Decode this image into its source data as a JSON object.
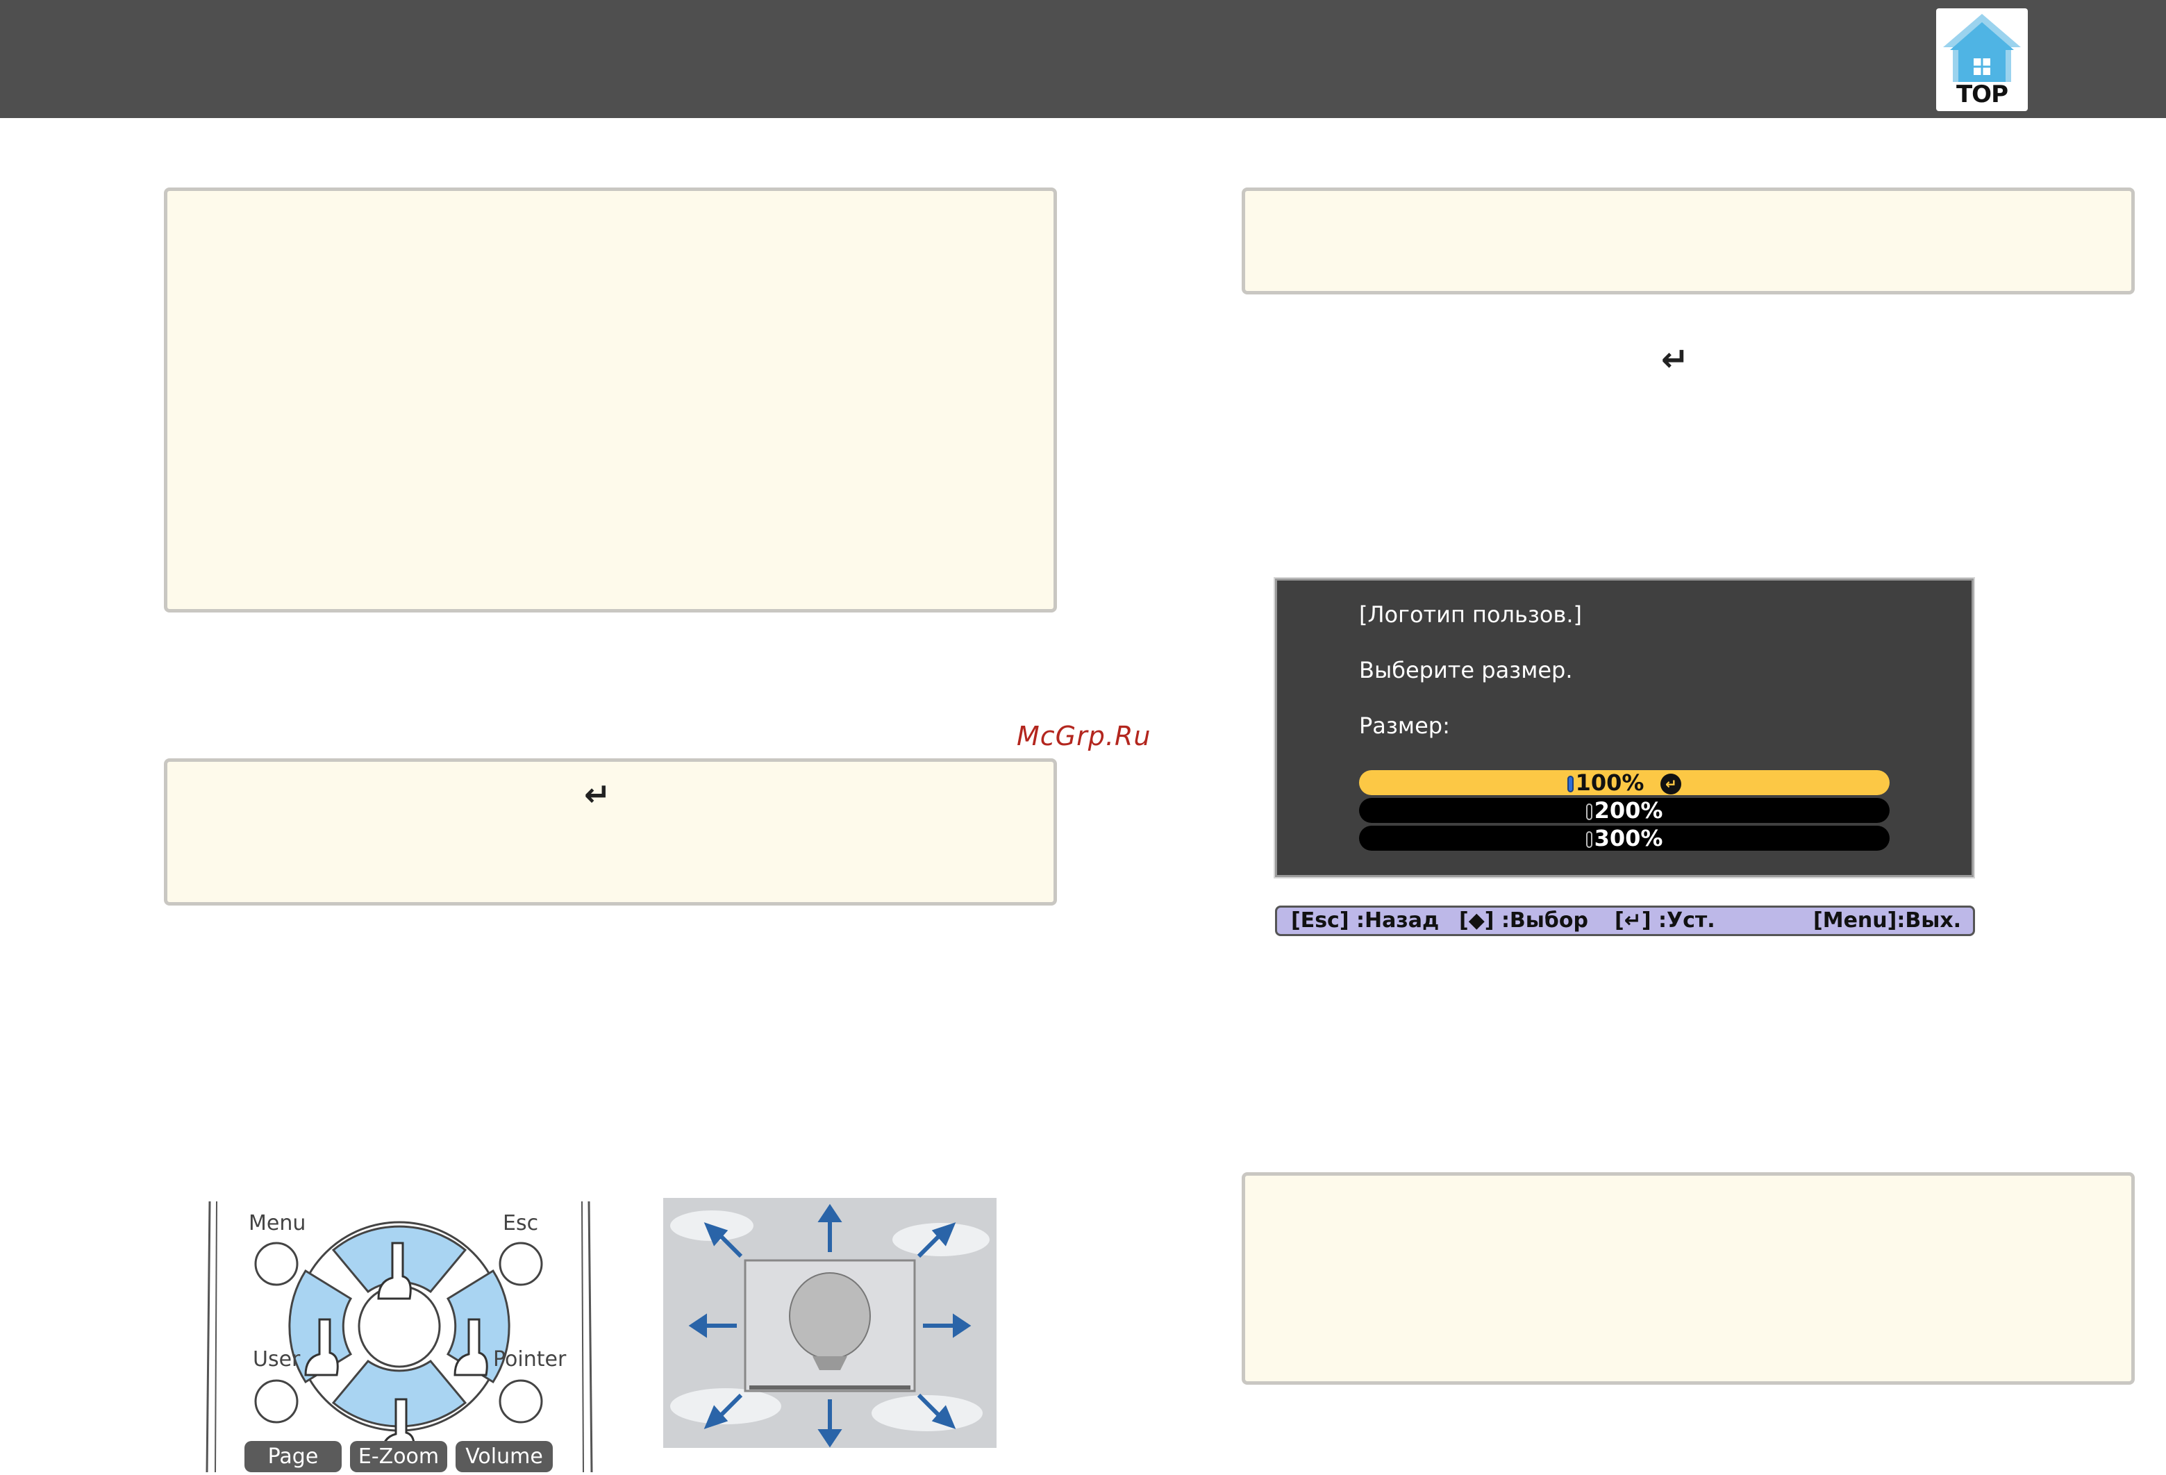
{
  "header": {
    "logo_label": "TOP"
  },
  "watermark": "McGrp.Ru",
  "menu": {
    "title": "[Логотип пользов.]",
    "prompt": "Выберите размер.",
    "field_label": "Размер:",
    "options": [
      "100%",
      "200%",
      "300%"
    ],
    "selected_index": 0
  },
  "help_bar": {
    "esc": "[Esc] :Назад",
    "select": "[◆] :Выбор",
    "set": "[↵] :Уст.",
    "menu": "[Menu]:Вых."
  },
  "remote": {
    "buttons": [
      "Menu",
      "Esc",
      "User",
      "Pointer",
      "Page",
      "E-Zoom",
      "Volume"
    ]
  },
  "colors": {
    "header_bg": "#4f4f4f",
    "note_bg": "#fefaeb",
    "menu_bg": "#404040",
    "menu_selected": "#fcc845",
    "help_bar_bg": "#bdb8e8",
    "remote_dpad": "#a9d4f2",
    "watermark": "#b3261e"
  }
}
